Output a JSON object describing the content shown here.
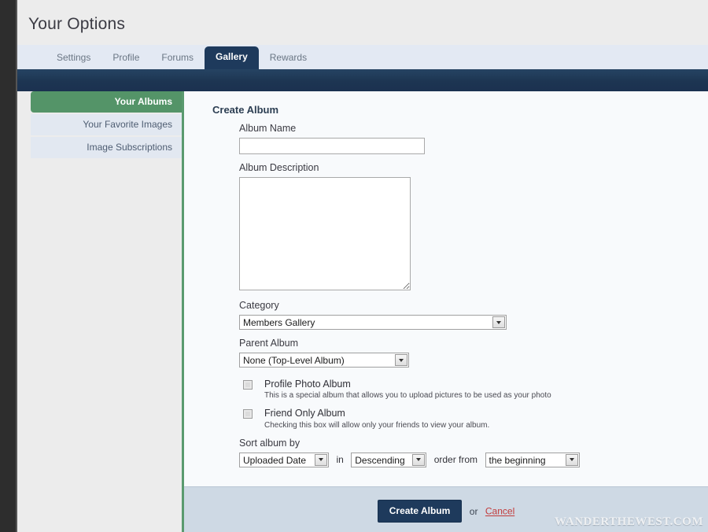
{
  "header": {
    "title": "Your Options"
  },
  "tabs": [
    {
      "label": "Settings",
      "active": false
    },
    {
      "label": "Profile",
      "active": false
    },
    {
      "label": "Forums",
      "active": false
    },
    {
      "label": "Gallery",
      "active": true
    },
    {
      "label": "Rewards",
      "active": false
    }
  ],
  "sidebar": {
    "items": [
      {
        "label": "Your Albums",
        "active": true
      },
      {
        "label": "Your Favorite Images",
        "active": false
      },
      {
        "label": "Image Subscriptions",
        "active": false
      }
    ]
  },
  "panel": {
    "title": "Create Album",
    "album_name": {
      "label": "Album Name",
      "value": "",
      "placeholder": ""
    },
    "album_description": {
      "label": "Album Description",
      "value": "",
      "placeholder": ""
    },
    "category": {
      "label": "Category",
      "selected": "Members Gallery"
    },
    "parent_album": {
      "label": "Parent Album",
      "selected": "None (Top-Level Album)"
    },
    "profile_photo_album": {
      "title": "Profile Photo Album",
      "description": "This is a special album that allows you to upload pictures to be used as your photo",
      "checked": false
    },
    "friend_only_album": {
      "title": "Friend Only Album",
      "description": "Checking this box will allow only your friends to view your album.",
      "checked": false
    },
    "sort": {
      "label": "Sort album by",
      "field_selected": "Uploaded Date",
      "joiner_in": "in",
      "direction_selected": "Descending",
      "joiner_order_from": "order from",
      "from_selected": "the beginning"
    }
  },
  "footer": {
    "submit_label": "Create Album",
    "or_text": "or",
    "cancel_label": "Cancel"
  },
  "watermark": {
    "text": "WANDERTHEWEST.COM"
  },
  "colors": {
    "navy": "#1e3a5c",
    "green": "#549468",
    "tabbar": "#e3e9f3",
    "footer": "#ced9e4",
    "cancel_red": "#c23b3b"
  }
}
